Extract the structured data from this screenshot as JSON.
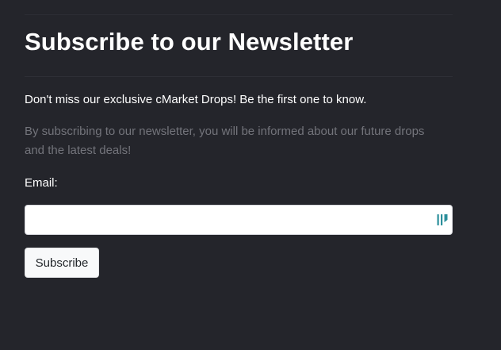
{
  "newsletter": {
    "title": "Subscribe to our Newsletter",
    "lead": "Don't miss our exclusive cMarket Drops! Be the first one to know.",
    "description": "By subscribing to our newsletter, you will be informed about our future drops and the latest deals!",
    "email_label": "Email:",
    "email_value": "",
    "email_placeholder": "",
    "subscribe_label": "Subscribe"
  },
  "icons": {
    "input_autofill": "password-manager-autofill-icon"
  },
  "colors": {
    "background": "#24252b",
    "heading_text": "#ffffff",
    "muted_text": "#73747b",
    "input_background": "#ffffff",
    "button_background": "#f8f9fa",
    "autofill_icon": "#2b8f9b"
  }
}
